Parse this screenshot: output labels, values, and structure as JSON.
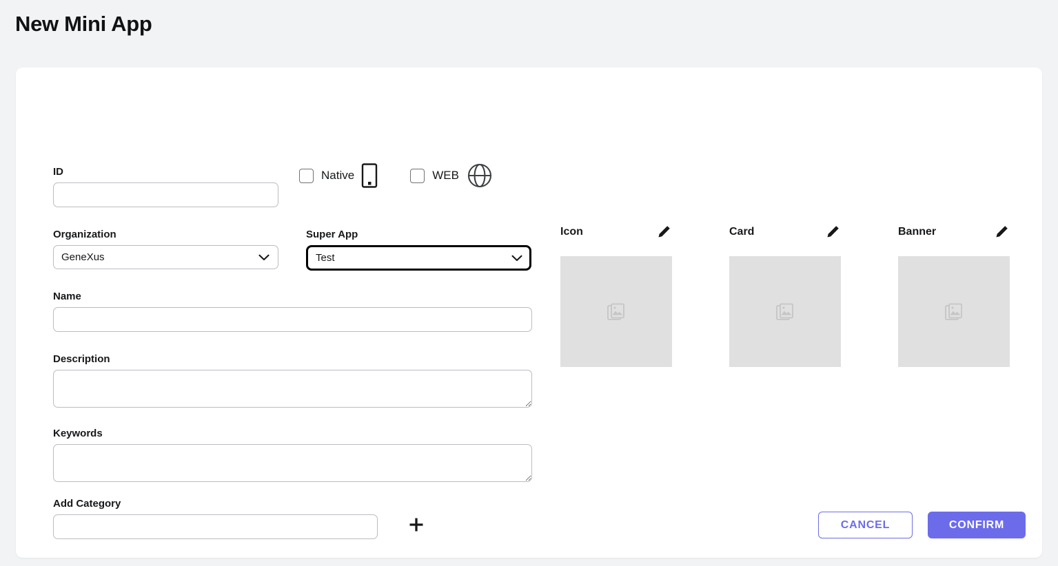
{
  "page": {
    "title": "New Mini App",
    "background_color": "#f2f3f5",
    "card_color": "#ffffff"
  },
  "form": {
    "id": {
      "label": "ID",
      "value": "",
      "placeholder": ""
    },
    "platforms": [
      {
        "label": "Native",
        "checked": false,
        "icon": "mobile-phone-icon"
      },
      {
        "label": "WEB",
        "checked": false,
        "icon": "globe-icon"
      }
    ],
    "organization": {
      "label": "Organization",
      "value": "GeneXus",
      "options": [
        "GeneXus"
      ]
    },
    "super_app": {
      "label": "Super App",
      "value": "Test",
      "options": [
        "Test"
      ],
      "focused": true
    },
    "name": {
      "label": "Name",
      "value": "",
      "placeholder": ""
    },
    "description": {
      "label": "Description",
      "value": "",
      "placeholder": ""
    },
    "keywords": {
      "label": "Keywords",
      "value": "",
      "placeholder": ""
    },
    "add_category": {
      "label": "Add Category",
      "value": "",
      "placeholder": "",
      "add_button_icon": "plus-icon"
    }
  },
  "media": [
    {
      "title": "Icon",
      "edit_icon": "pencil-icon",
      "placeholder_icon": "image-placeholder-icon"
    },
    {
      "title": "Card",
      "edit_icon": "pencil-icon",
      "placeholder_icon": "image-placeholder-icon"
    },
    {
      "title": "Banner",
      "edit_icon": "pencil-icon",
      "placeholder_icon": "image-placeholder-icon"
    }
  ],
  "footer": {
    "cancel_label": "CANCEL",
    "confirm_label": "CONFIRM",
    "accent_color": "#6c6ceb"
  }
}
